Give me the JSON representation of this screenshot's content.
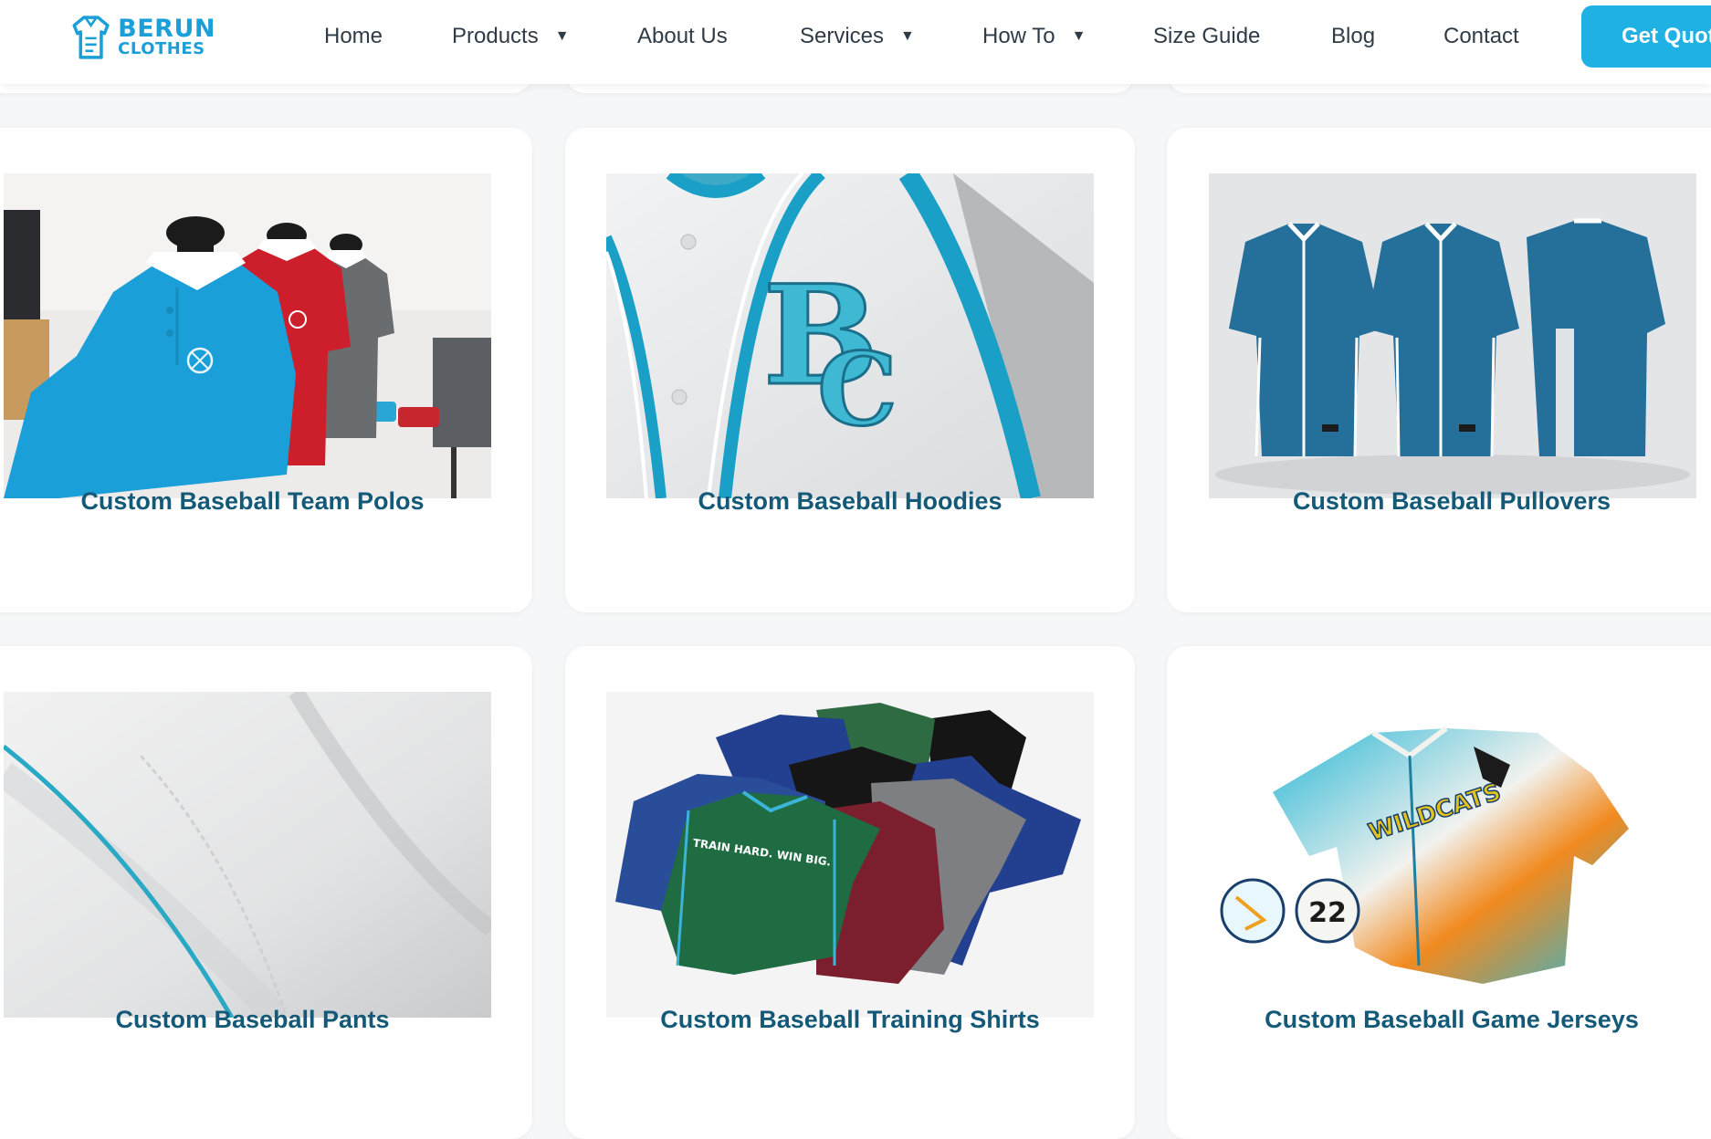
{
  "brand": {
    "line1": "BERUN",
    "line2": "CLOTHES",
    "color": "#1a9fd8"
  },
  "nav": {
    "items": [
      {
        "label": "Home",
        "dropdown": false
      },
      {
        "label": "Products",
        "dropdown": true
      },
      {
        "label": "About Us",
        "dropdown": false
      },
      {
        "label": "Services",
        "dropdown": true
      },
      {
        "label": "How To",
        "dropdown": true
      },
      {
        "label": "Size Guide",
        "dropdown": false
      },
      {
        "label": "Blog",
        "dropdown": false
      },
      {
        "label": "Contact",
        "dropdown": false
      }
    ],
    "caret": "▼",
    "cta_label": "Get Quote",
    "cta_color": "#1fb0e4"
  },
  "products": [
    {
      "title": "Custom Baseball Team Polos",
      "image": "polo-mannequins-photo"
    },
    {
      "title": "Custom Baseball Hoodies",
      "image": "embroidered-jersey-closeup-photo"
    },
    {
      "title": "Custom Baseball Pullovers",
      "image": "blue-jersey-trio-photo"
    },
    {
      "title": "Custom Baseball Pants",
      "image": "white-pants-piping-photo"
    },
    {
      "title": "Custom Baseball Training Shirts",
      "image": "training-shirts-stack-photo"
    },
    {
      "title": "Custom Baseball Game Jerseys",
      "image": "wildcats-jersey-photo"
    }
  ],
  "image_text": {
    "training_print": "TRAIN HARD. WIN BIG.",
    "jersey_wordmark": "WILDCATS",
    "jersey_number": "22"
  },
  "colors": {
    "title": "#145a78",
    "accent": "#20a9c9"
  }
}
